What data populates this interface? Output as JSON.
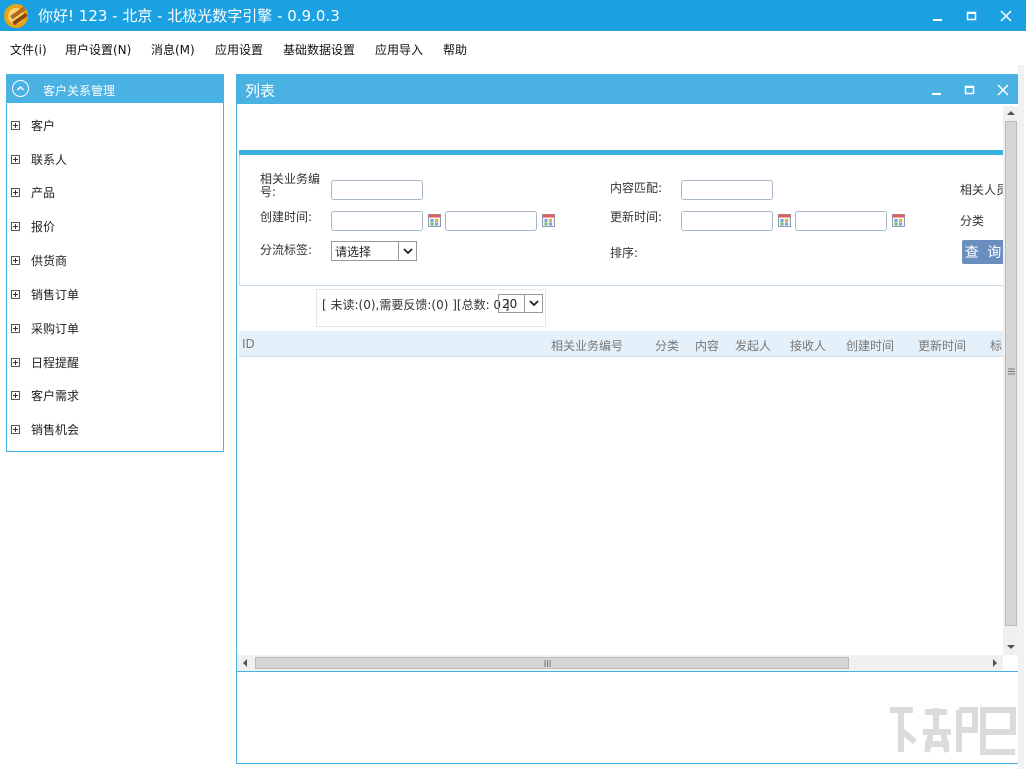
{
  "window": {
    "title": "你好! 123 - 北京 - 北极光数字引擎 - 0.9.0.3",
    "accent": "#1ba1e2"
  },
  "menu": [
    "文件(i)",
    "用户设置(N)",
    "消息(M)",
    "应用设置",
    "基础数据设置",
    "应用导入",
    "帮助"
  ],
  "sidebar": {
    "header": "客户关系管理",
    "items": [
      "客户",
      "联系人",
      "产品",
      "报价",
      "供货商",
      "销售订单",
      "采购订单",
      "日程提醒",
      "客户需求",
      "销售机会"
    ]
  },
  "panel": {
    "title": "列表",
    "filters": {
      "related_no_label": "相关业务编号:",
      "content_match_label": "内容匹配:",
      "related_person_label": "相关人员",
      "created_label": "创建时间:",
      "updated_label": "更新时间:",
      "category_label": "分类",
      "tag_label": "分流标签:",
      "tag_selected": "请选择",
      "sort_label": "排序:",
      "query_button": "查 询"
    },
    "pager": {
      "status": "[ 未读:(0),需要反馈:(0) ][总数: 0 ]",
      "page_size": "20"
    },
    "columns": [
      "ID",
      "相关业务编号",
      "分类",
      "内容",
      "发起人",
      "接收人",
      "创建时间",
      "更新时间",
      "标"
    ],
    "rows": []
  }
}
